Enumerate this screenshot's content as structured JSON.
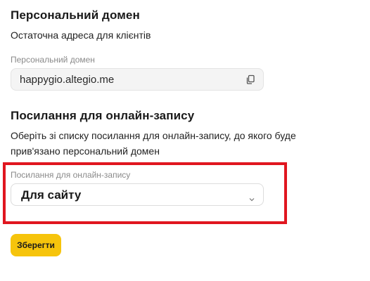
{
  "domain_section": {
    "title": "Персональний домен",
    "description": "Остаточна адреса для клієнтів",
    "field_label": "Персональний домен",
    "field_value": "happygio.altegio.me",
    "copy_icon": "copy-icon"
  },
  "link_section": {
    "title": "Посилання для онлайн-запису",
    "description_line1": "Оберіть зі списку посилання для онлайн-запису, до якого буде",
    "description_line2": "прив'язано персональний домен",
    "field_label": "Посилання для онлайн-запису",
    "selected_value": "Для сайту",
    "chevron_icon": "chevron-down-icon"
  },
  "actions": {
    "save_label": "Зберегти"
  },
  "colors": {
    "accent": "#f6c40c",
    "highlight": "#e0161f"
  }
}
